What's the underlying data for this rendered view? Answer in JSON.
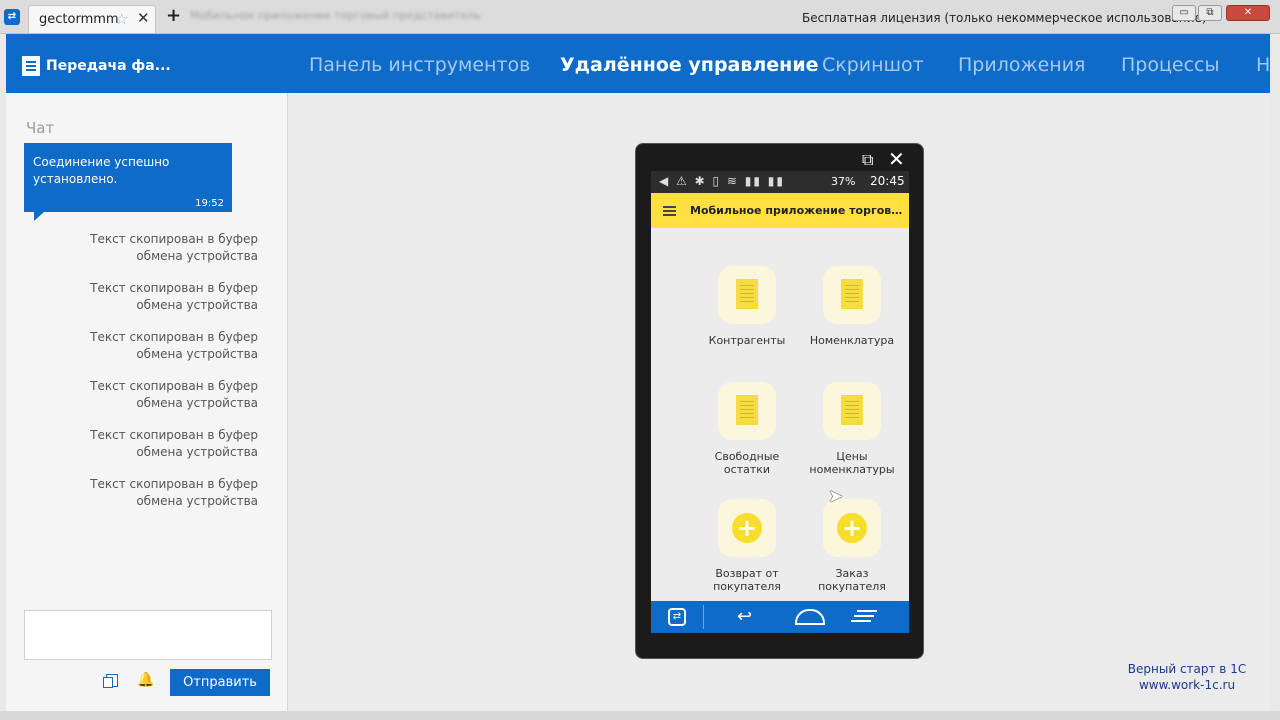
{
  "window": {
    "tab_title": "gectormmm",
    "blurred_title": "Мобильное приложение торговый представитель",
    "license_text": "Бесплатная лицензия (только некоммерческое использование)",
    "minimize_glyph": "▭",
    "maximize_glyph": "⧉",
    "close_glyph": "✕"
  },
  "header": {
    "brand": "Передача фа...",
    "nav": [
      {
        "label": "Панель инструментов",
        "active": false
      },
      {
        "label": "Удалённое управление",
        "active": true
      },
      {
        "label": "Скриншот",
        "active": false
      },
      {
        "label": "Приложения",
        "active": false
      },
      {
        "label": "Процессы",
        "active": false
      },
      {
        "label": "Н",
        "active": false
      }
    ]
  },
  "chat": {
    "title": "Чат",
    "bubble": {
      "text": "Соединение успешно установлено.",
      "time": "19:52"
    },
    "system_messages": [
      "Текст скопирован в буфер обмена устройства",
      "Текст скопирован в буфер обмена устройства",
      "Текст скопирован в буфер обмена устройства",
      "Текст скопирован в буфер обмена устройства",
      "Текст скопирован в буфер обмена устройства",
      "Текст скопирован в буфер обмена устройства"
    ],
    "input_value": "",
    "send_label": "Отправить"
  },
  "phone": {
    "status": {
      "battery": "37%",
      "time": "20:45"
    },
    "app_title": "Мобильное приложение торговый пр...",
    "tiles": [
      {
        "label": "Контрагенты",
        "icon": "document-icon"
      },
      {
        "label": "Номенклатура",
        "icon": "document-icon"
      },
      {
        "label": "Свободные остатки",
        "icon": "document-icon"
      },
      {
        "label": "Цены номенклатуры",
        "icon": "document-icon"
      },
      {
        "label": "Возврат от покупателя",
        "icon": "plus-circle-icon"
      },
      {
        "label": "Заказ покупателя",
        "icon": "plus-circle-icon"
      }
    ],
    "page_indicator": {
      "count": 2,
      "current": 2
    }
  },
  "watermark": {
    "line1": "Верный старт в 1С",
    "line2": "www.work-1c.ru"
  },
  "colors": {
    "brand_blue": "#0e6bc7",
    "app_yellow": "#ffe040"
  }
}
